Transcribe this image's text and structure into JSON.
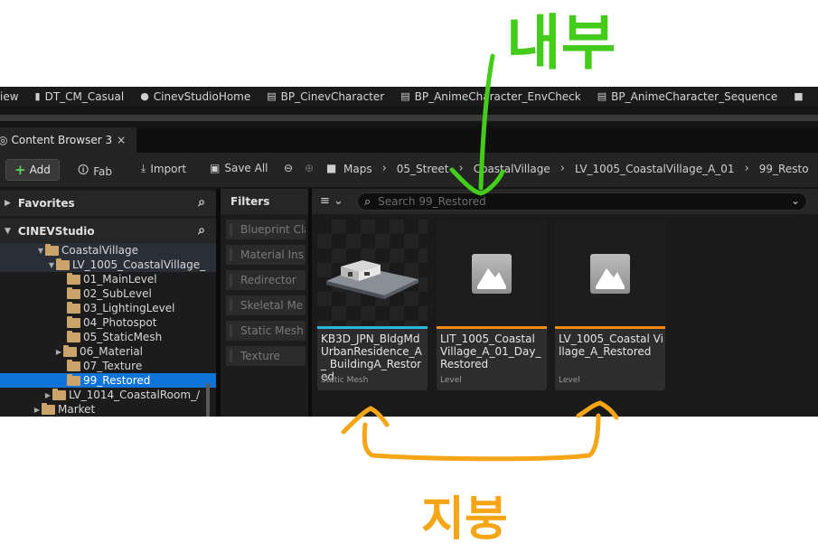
{
  "bookmarks": [
    {
      "label": "iew",
      "icon": "none"
    },
    {
      "label": "DT_CM_Casual",
      "icon": "datatable-icon"
    },
    {
      "label": "CinevStudioHome",
      "icon": "sphere-icon"
    },
    {
      "label": "BP_CinevCharacter",
      "icon": "blueprint-icon"
    },
    {
      "label": "BP_AnimeCharacter_EnvCheck",
      "icon": "blueprint-icon"
    },
    {
      "label": "BP_AnimeCharacter_Sequence",
      "icon": "blueprint-icon"
    }
  ],
  "tab": {
    "label": "Content Browser 3",
    "close": "×"
  },
  "toolbar": {
    "add_label": "Add",
    "fab_label": "Fab",
    "import_label": "Import",
    "saveall_label": "Save All",
    "breadcrumbs": [
      "Maps",
      "05_Street",
      "CoastalVillage",
      "LV_1005_CoastalVillage_A_01",
      "99_Resto"
    ]
  },
  "left_panel": {
    "favorites_label": "Favorites",
    "root_label": "CINEVStudio",
    "tree": [
      {
        "label": "CoastalVillage",
        "caret": "▼"
      },
      {
        "label": "LV_1005_CoastalVillage_",
        "caret": "▼"
      },
      {
        "label": "01_MainLevel",
        "caret": ""
      },
      {
        "label": "02_SubLevel",
        "caret": ""
      },
      {
        "label": "03_LightingLevel",
        "caret": ""
      },
      {
        "label": "04_Photospot",
        "caret": ""
      },
      {
        "label": "05_StaticMesh",
        "caret": ""
      },
      {
        "label": "06_Material",
        "caret": "▶"
      },
      {
        "label": "07_Texture",
        "caret": ""
      },
      {
        "label": "99_Restored",
        "caret": ""
      },
      {
        "label": "LV_1014_CoastalRoom_/",
        "caret": "▶"
      },
      {
        "label": "Market",
        "caret": "▶"
      }
    ]
  },
  "filters": {
    "header": "Filters",
    "items": [
      "Blueprint Cla",
      "Material Ins",
      "Redirector",
      "Skeletal Me",
      "Static Mesh",
      "Texture"
    ]
  },
  "assets": {
    "search_placeholder": "Search 99_Restored",
    "tiles": [
      {
        "name": "KB3D_JPN_BldgMd UrbanResidence_A_ BuildingA_Restored",
        "type": "Static Mesh",
        "accent": "#2ab8d8"
      },
      {
        "name": "LIT_1005_Coastal Village_A_01_Day_ Restored",
        "type": "Level",
        "accent": "#f08a12"
      },
      {
        "name": "LV_1005_Coastal Village_A_Restored",
        "type": "Level",
        "accent": "#f08a12"
      }
    ]
  },
  "annotations": {
    "top_text": "내부",
    "top_color": "#44cc1a",
    "bottom_text": "지붕",
    "bottom_color": "#f5a515"
  }
}
